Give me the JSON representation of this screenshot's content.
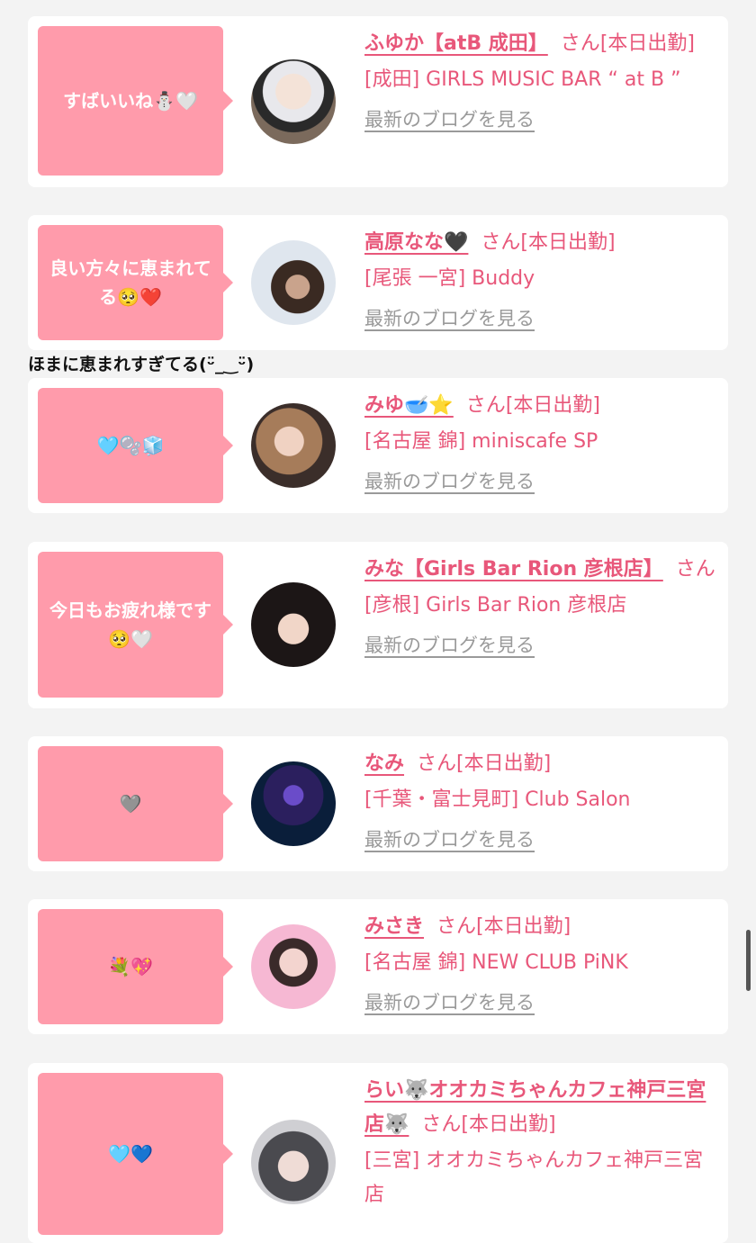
{
  "caption": "ほまに恵まれすぎてる(ᵕ̈_‿ᵕ̈)",
  "blog_link": "最新のブログを見る",
  "san": "さん",
  "colors": {
    "accent": "#e8577a",
    "bubble": "#ff9bab",
    "background": "#f3f3f3"
  },
  "cards": [
    {
      "comment": "すばいいね⛄🤍",
      "name": "ふゆか【atB 成田】",
      "status": "[本日出勤]",
      "shop": "[成田] GIRLS MUSIC BAR “ at B ”"
    },
    {
      "comment": "良い方々に恵まれてる🥺❤️",
      "name": "高原なな🖤",
      "status": "[本日出勤]",
      "shop": "[尾張 一宮] Buddy"
    },
    {
      "comment": "🩵🫧🧊",
      "name": "みゆ🥣⭐",
      "status": "[本日出勤]",
      "shop": "[名古屋 錦] miniscafe SP"
    },
    {
      "comment": "今日もお疲れ様です🥺🤍",
      "name": "みな【Girls Bar Rion 彦根店】",
      "status": "",
      "shop": "[彦根] Girls Bar Rion 彦根店"
    },
    {
      "comment": "🩶",
      "name": "なみ",
      "status": "[本日出勤]",
      "shop": "[千葉・富士見町] Club Salon"
    },
    {
      "comment": "💐💖",
      "name": "みさき",
      "status": "[本日出勤]",
      "shop": "[名古屋 錦] NEW CLUB PiNK"
    },
    {
      "comment": "🩵💙",
      "name": "らい🐺オオカミちゃんカフェ神戸三宮店🐺",
      "status": "[本日出勤]",
      "shop": "[三宮] オオカミちゃんカフェ神戸三宮店"
    }
  ]
}
